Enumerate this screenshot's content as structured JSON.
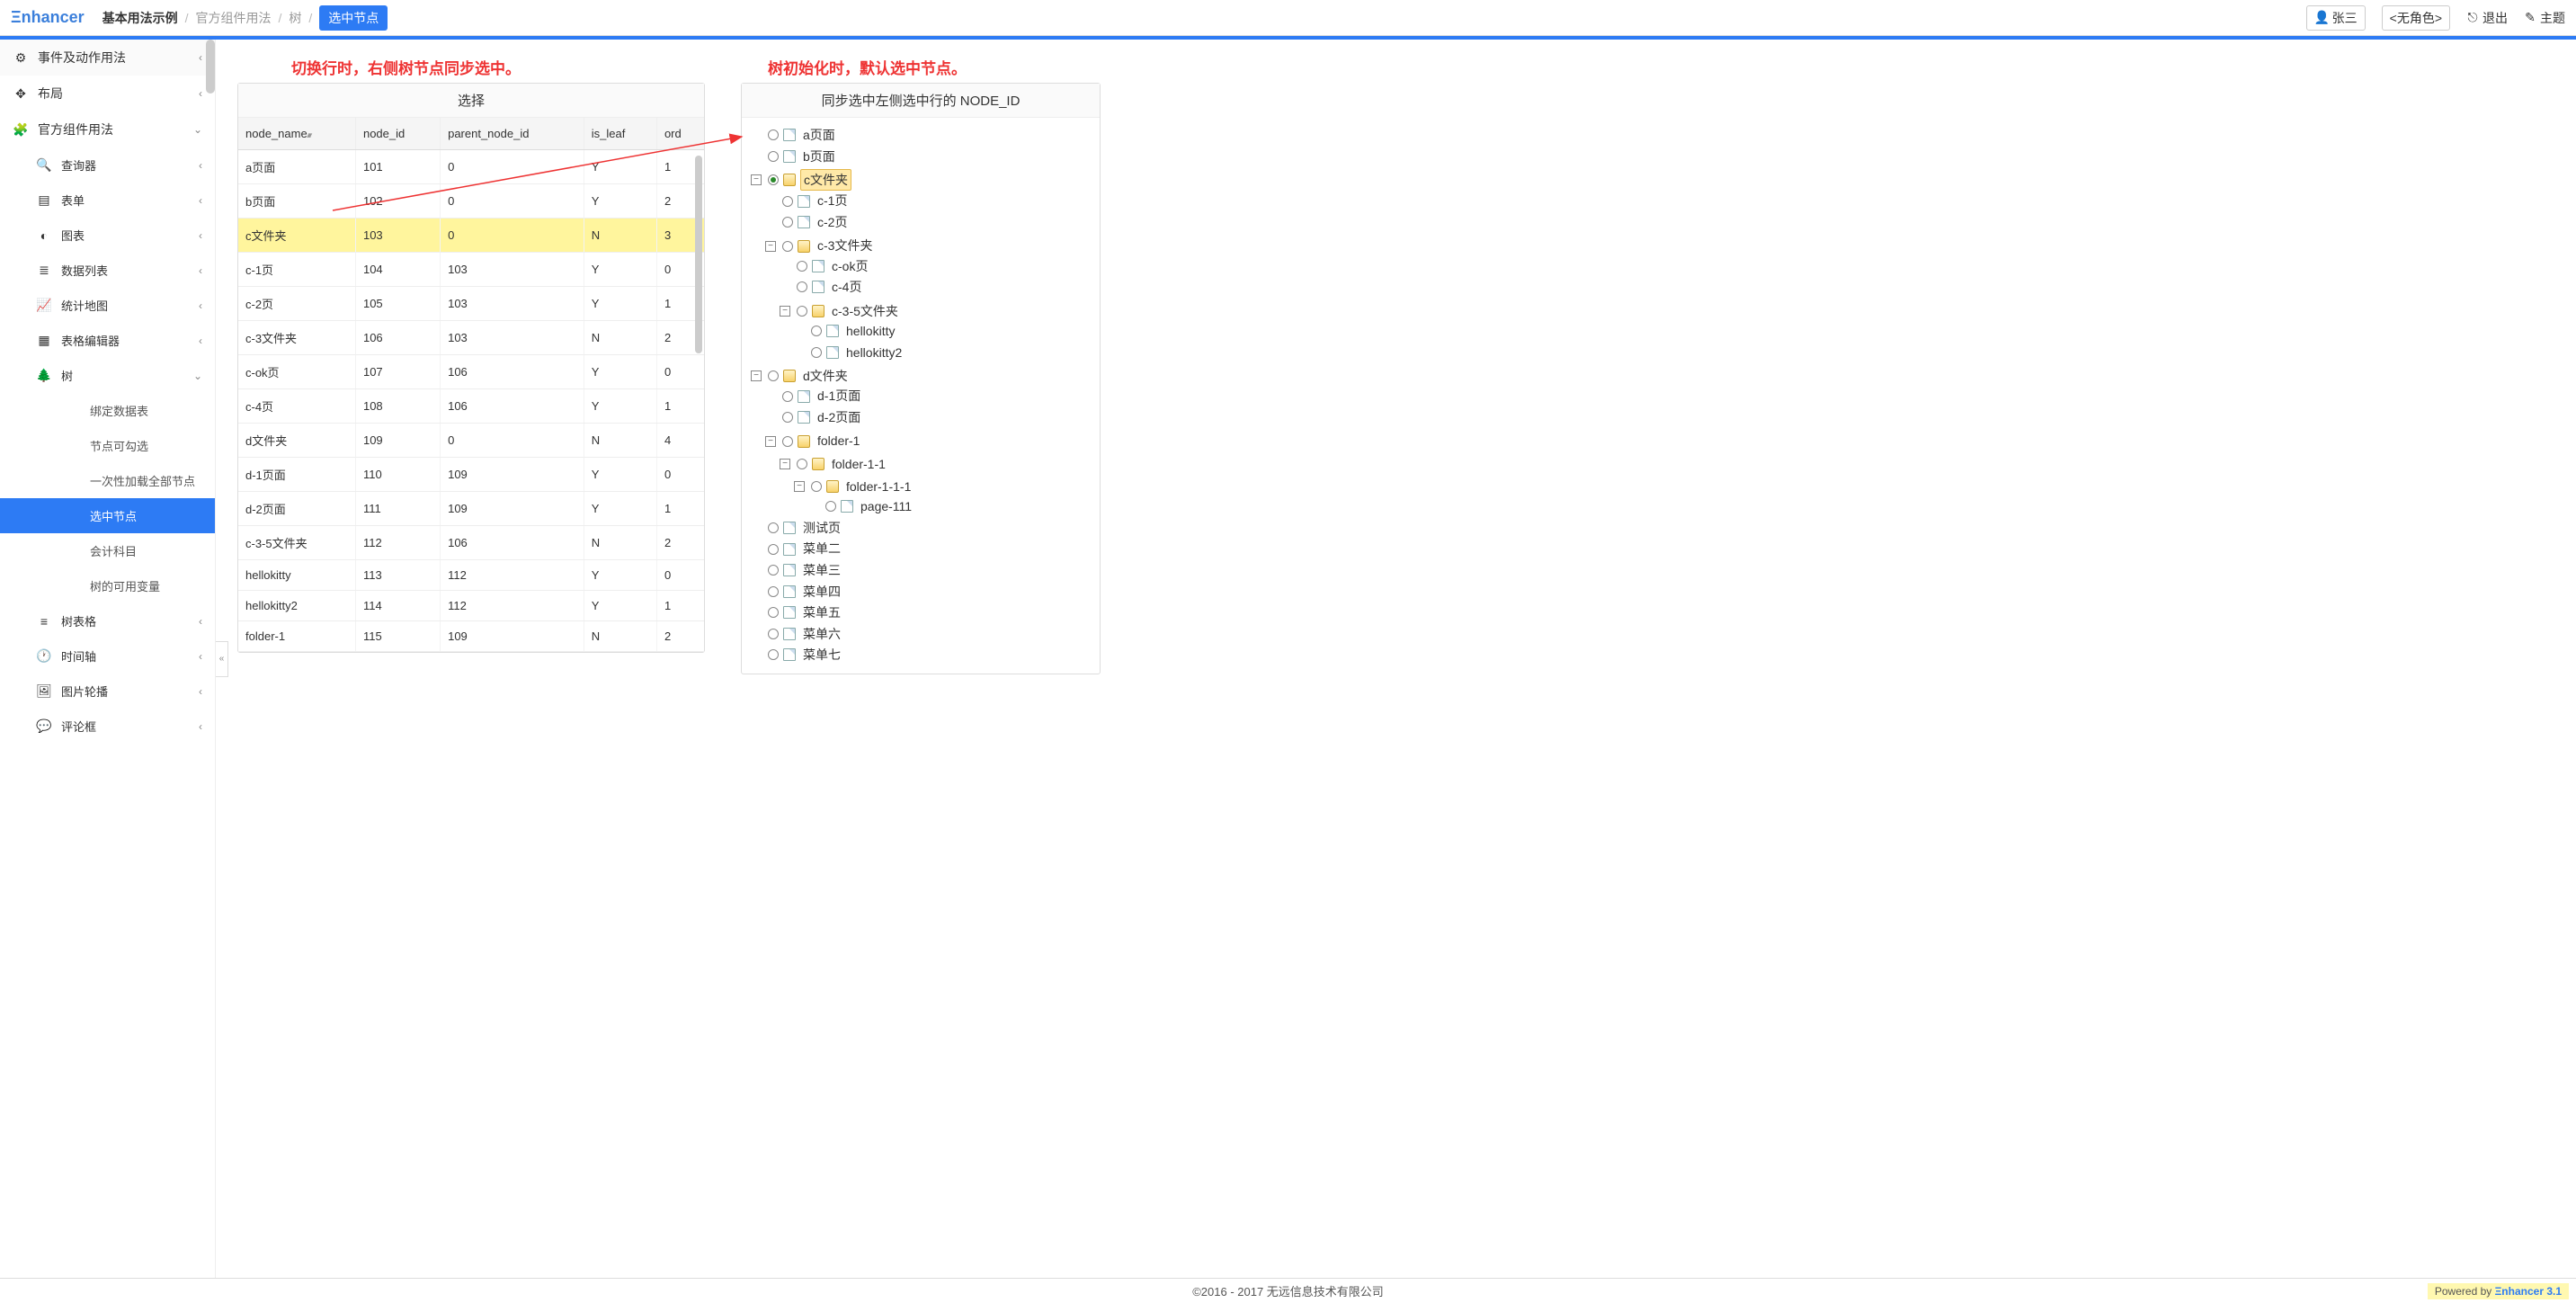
{
  "logo": "Ξnhancer",
  "breadcrumb": {
    "root": "基本用法示例",
    "items": [
      "官方组件用法",
      "树"
    ],
    "current": "选中节点"
  },
  "topbar": {
    "user": "张三",
    "role": "<无角色>",
    "logout": "退出",
    "theme": "主题"
  },
  "sidebar": {
    "items": [
      {
        "icon": "⚙",
        "label": "事件及动作用法",
        "chev": "‹",
        "top": true,
        "badge": true
      },
      {
        "icon": "✥",
        "label": "布局",
        "chev": "‹"
      },
      {
        "icon": "🧩",
        "label": "官方组件用法",
        "chev": "⌄"
      },
      {
        "icon": "🔍",
        "label": "查询器",
        "chev": "‹",
        "sub": true
      },
      {
        "icon": "▤",
        "label": "表单",
        "chev": "‹",
        "sub": true
      },
      {
        "icon": "◐",
        "label": "图表",
        "chev": "‹",
        "sub": true
      },
      {
        "icon": "≣",
        "label": "数据列表",
        "chev": "‹",
        "sub": true
      },
      {
        "icon": "📈",
        "label": "统计地图",
        "chev": "‹",
        "sub": true
      },
      {
        "icon": "▦",
        "label": "表格编辑器",
        "chev": "‹",
        "sub": true
      },
      {
        "icon": "🌲",
        "label": "树",
        "chev": "⌄",
        "sub": true
      },
      {
        "label": "绑定数据表",
        "subsub": true
      },
      {
        "label": "节点可勾选",
        "subsub": true
      },
      {
        "label": "一次性加载全部节点",
        "subsub": true
      },
      {
        "label": "选中节点",
        "subsub": true,
        "active": true
      },
      {
        "label": "会计科目",
        "subsub": true
      },
      {
        "label": "树的可用变量",
        "subsub": true
      },
      {
        "icon": "≡",
        "label": "树表格",
        "chev": "‹",
        "sub": true
      },
      {
        "icon": "🕐",
        "label": "时间轴",
        "chev": "‹",
        "sub": true
      },
      {
        "icon": "🖼",
        "label": "图片轮播",
        "chev": "‹",
        "sub": true
      },
      {
        "icon": "💬",
        "label": "评论框",
        "chev": "‹",
        "sub": true
      }
    ]
  },
  "annotations": {
    "left": "切换行时，右侧树节点同步选中。",
    "right": "树初始化时，默认选中节点。"
  },
  "table": {
    "title": "选择",
    "columns": [
      "node_name",
      "node_id",
      "parent_node_id",
      "is_leaf",
      "ord"
    ],
    "rows": [
      {
        "node_name": "a页面",
        "node_id": "101",
        "parent_node_id": "0",
        "is_leaf": "Y",
        "ord": "1"
      },
      {
        "node_name": "b页面",
        "node_id": "102",
        "parent_node_id": "0",
        "is_leaf": "Y",
        "ord": "2"
      },
      {
        "node_name": "c文件夹",
        "node_id": "103",
        "parent_node_id": "0",
        "is_leaf": "N",
        "ord": "3",
        "highlight": true
      },
      {
        "node_name": "c-1页",
        "node_id": "104",
        "parent_node_id": "103",
        "is_leaf": "Y",
        "ord": "0"
      },
      {
        "node_name": "c-2页",
        "node_id": "105",
        "parent_node_id": "103",
        "is_leaf": "Y",
        "ord": "1"
      },
      {
        "node_name": "c-3文件夹",
        "node_id": "106",
        "parent_node_id": "103",
        "is_leaf": "N",
        "ord": "2"
      },
      {
        "node_name": "c-ok页",
        "node_id": "107",
        "parent_node_id": "106",
        "is_leaf": "Y",
        "ord": "0"
      },
      {
        "node_name": "c-4页",
        "node_id": "108",
        "parent_node_id": "106",
        "is_leaf": "Y",
        "ord": "1"
      },
      {
        "node_name": "d文件夹",
        "node_id": "109",
        "parent_node_id": "0",
        "is_leaf": "N",
        "ord": "4"
      },
      {
        "node_name": "d-1页面",
        "node_id": "110",
        "parent_node_id": "109",
        "is_leaf": "Y",
        "ord": "0"
      },
      {
        "node_name": "d-2页面",
        "node_id": "111",
        "parent_node_id": "109",
        "is_leaf": "Y",
        "ord": "1"
      },
      {
        "node_name": "c-3-5文件夹",
        "node_id": "112",
        "parent_node_id": "106",
        "is_leaf": "N",
        "ord": "2"
      },
      {
        "node_name": "hellokitty",
        "node_id": "113",
        "parent_node_id": "112",
        "is_leaf": "Y",
        "ord": "0"
      },
      {
        "node_name": "hellokitty2",
        "node_id": "114",
        "parent_node_id": "112",
        "is_leaf": "Y",
        "ord": "1"
      },
      {
        "node_name": "folder-1",
        "node_id": "115",
        "parent_node_id": "109",
        "is_leaf": "N",
        "ord": "2"
      }
    ]
  },
  "tree": {
    "title": "同步选中左侧选中行的 NODE_ID",
    "nodes": [
      {
        "label": "a页面",
        "type": "file"
      },
      {
        "label": "b页面",
        "type": "file"
      },
      {
        "label": "c文件夹",
        "type": "folder-open",
        "toggle": "−",
        "selected": true,
        "checked": true,
        "children": [
          {
            "label": "c-1页",
            "type": "file"
          },
          {
            "label": "c-2页",
            "type": "file"
          },
          {
            "label": "c-3文件夹",
            "type": "folder-open",
            "toggle": "−",
            "children": [
              {
                "label": "c-ok页",
                "type": "file"
              },
              {
                "label": "c-4页",
                "type": "file"
              },
              {
                "label": "c-3-5文件夹",
                "type": "folder-open",
                "toggle": "−",
                "children": [
                  {
                    "label": "hellokitty",
                    "type": "file"
                  },
                  {
                    "label": "hellokitty2",
                    "type": "file"
                  }
                ]
              }
            ]
          }
        ]
      },
      {
        "label": "d文件夹",
        "type": "folder-open",
        "toggle": "−",
        "children": [
          {
            "label": "d-1页面",
            "type": "file"
          },
          {
            "label": "d-2页面",
            "type": "file"
          },
          {
            "label": "folder-1",
            "type": "folder-open",
            "toggle": "−",
            "children": [
              {
                "label": "folder-1-1",
                "type": "folder-open",
                "toggle": "−",
                "children": [
                  {
                    "label": "folder-1-1-1",
                    "type": "folder-open",
                    "toggle": "−",
                    "children": [
                      {
                        "label": "page-111",
                        "type": "file"
                      }
                    ]
                  }
                ]
              }
            ]
          }
        ]
      },
      {
        "label": "测试页",
        "type": "file"
      },
      {
        "label": "菜单二",
        "type": "file"
      },
      {
        "label": "菜单三",
        "type": "file"
      },
      {
        "label": "菜单四",
        "type": "file"
      },
      {
        "label": "菜单五",
        "type": "file"
      },
      {
        "label": "菜单六",
        "type": "file"
      },
      {
        "label": "菜单七",
        "type": "file"
      }
    ]
  },
  "footer": {
    "copyright": "©2016 - 2017 无远信息技术有限公司",
    "powered_prefix": "Powered by ",
    "powered_brand": "Ξnhancer 3.1"
  }
}
